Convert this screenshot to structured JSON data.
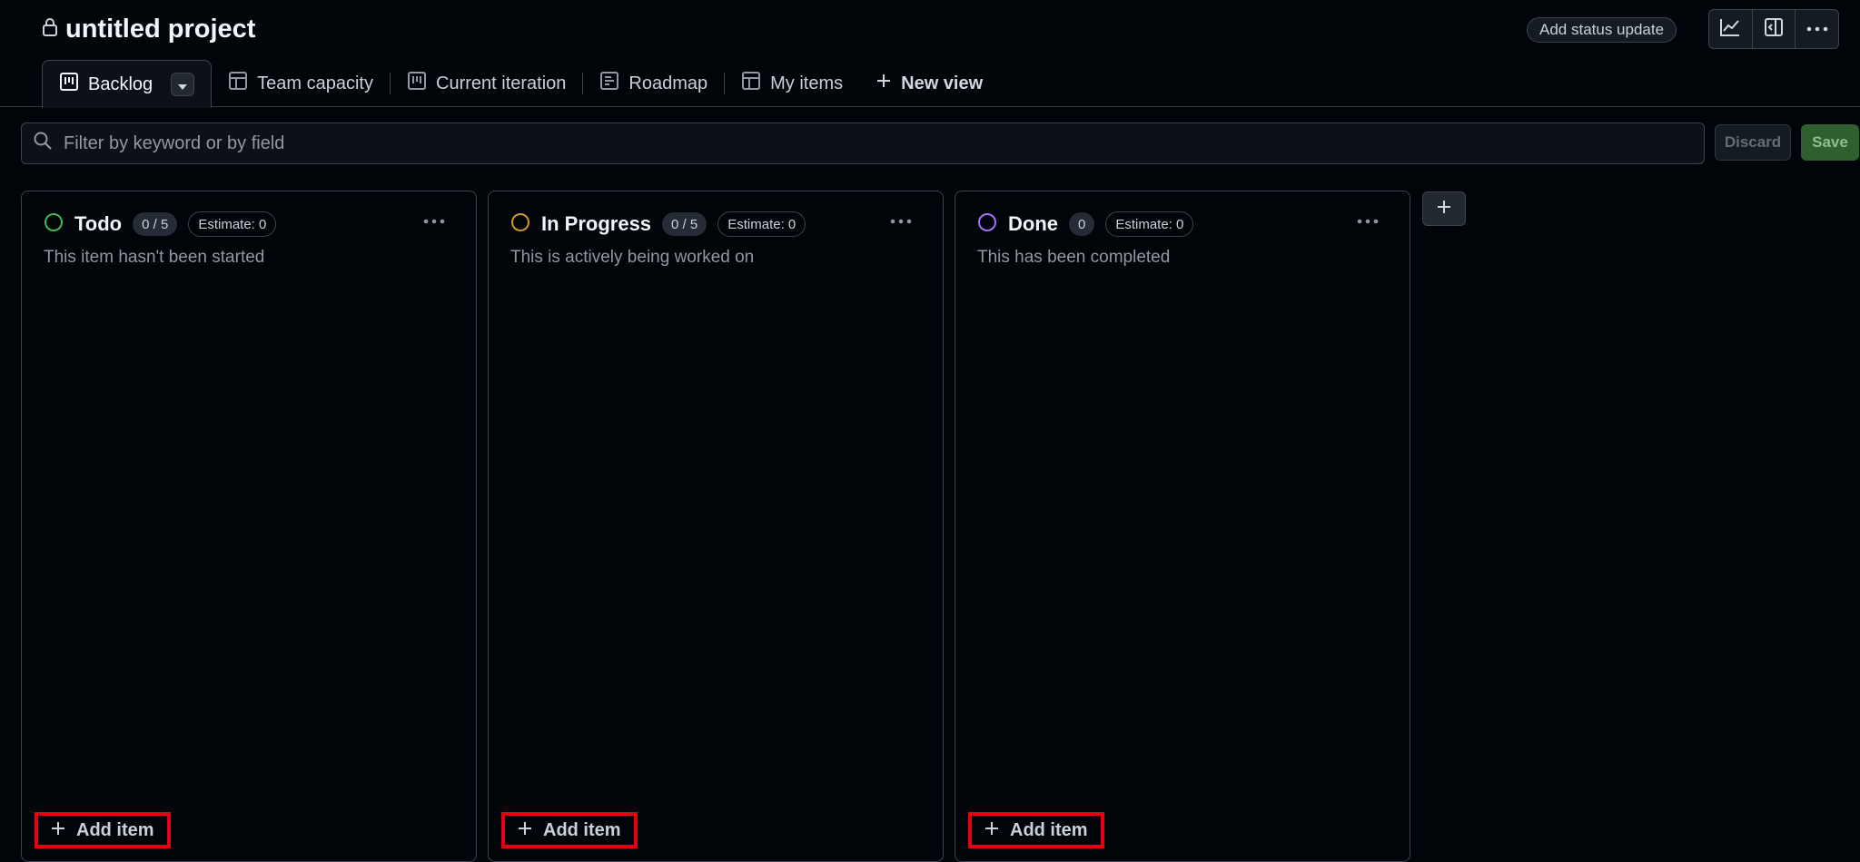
{
  "header": {
    "title": "untitled project",
    "status_button": "Add status update"
  },
  "tabs": [
    {
      "label": "Backlog",
      "icon": "board-icon"
    },
    {
      "label": "Team capacity",
      "icon": "table-icon"
    },
    {
      "label": "Current iteration",
      "icon": "board-icon"
    },
    {
      "label": "Roadmap",
      "icon": "roadmap-icon"
    },
    {
      "label": "My items",
      "icon": "table-icon"
    },
    {
      "label": "New view",
      "icon": "plus-icon"
    }
  ],
  "filter": {
    "placeholder": "Filter by keyword or by field",
    "discard_label": "Discard",
    "save_label": "Save"
  },
  "columns": [
    {
      "title": "Todo",
      "count": "0 / 5",
      "estimate": "Estimate: 0",
      "description": "This item hasn't been started",
      "add_label": "Add item",
      "color": "#3fb950"
    },
    {
      "title": "In Progress",
      "count": "0 / 5",
      "estimate": "Estimate: 0",
      "description": "This is actively being worked on",
      "add_label": "Add item",
      "color": "#d29922"
    },
    {
      "title": "Done",
      "count": "0",
      "estimate": "Estimate: 0",
      "description": "This has been completed",
      "add_label": "Add item",
      "color": "#a371f7"
    }
  ],
  "colors": {
    "background": "#010409",
    "border": "#3d444d",
    "highlight": "#e60012",
    "save": "#2f5f2f"
  }
}
